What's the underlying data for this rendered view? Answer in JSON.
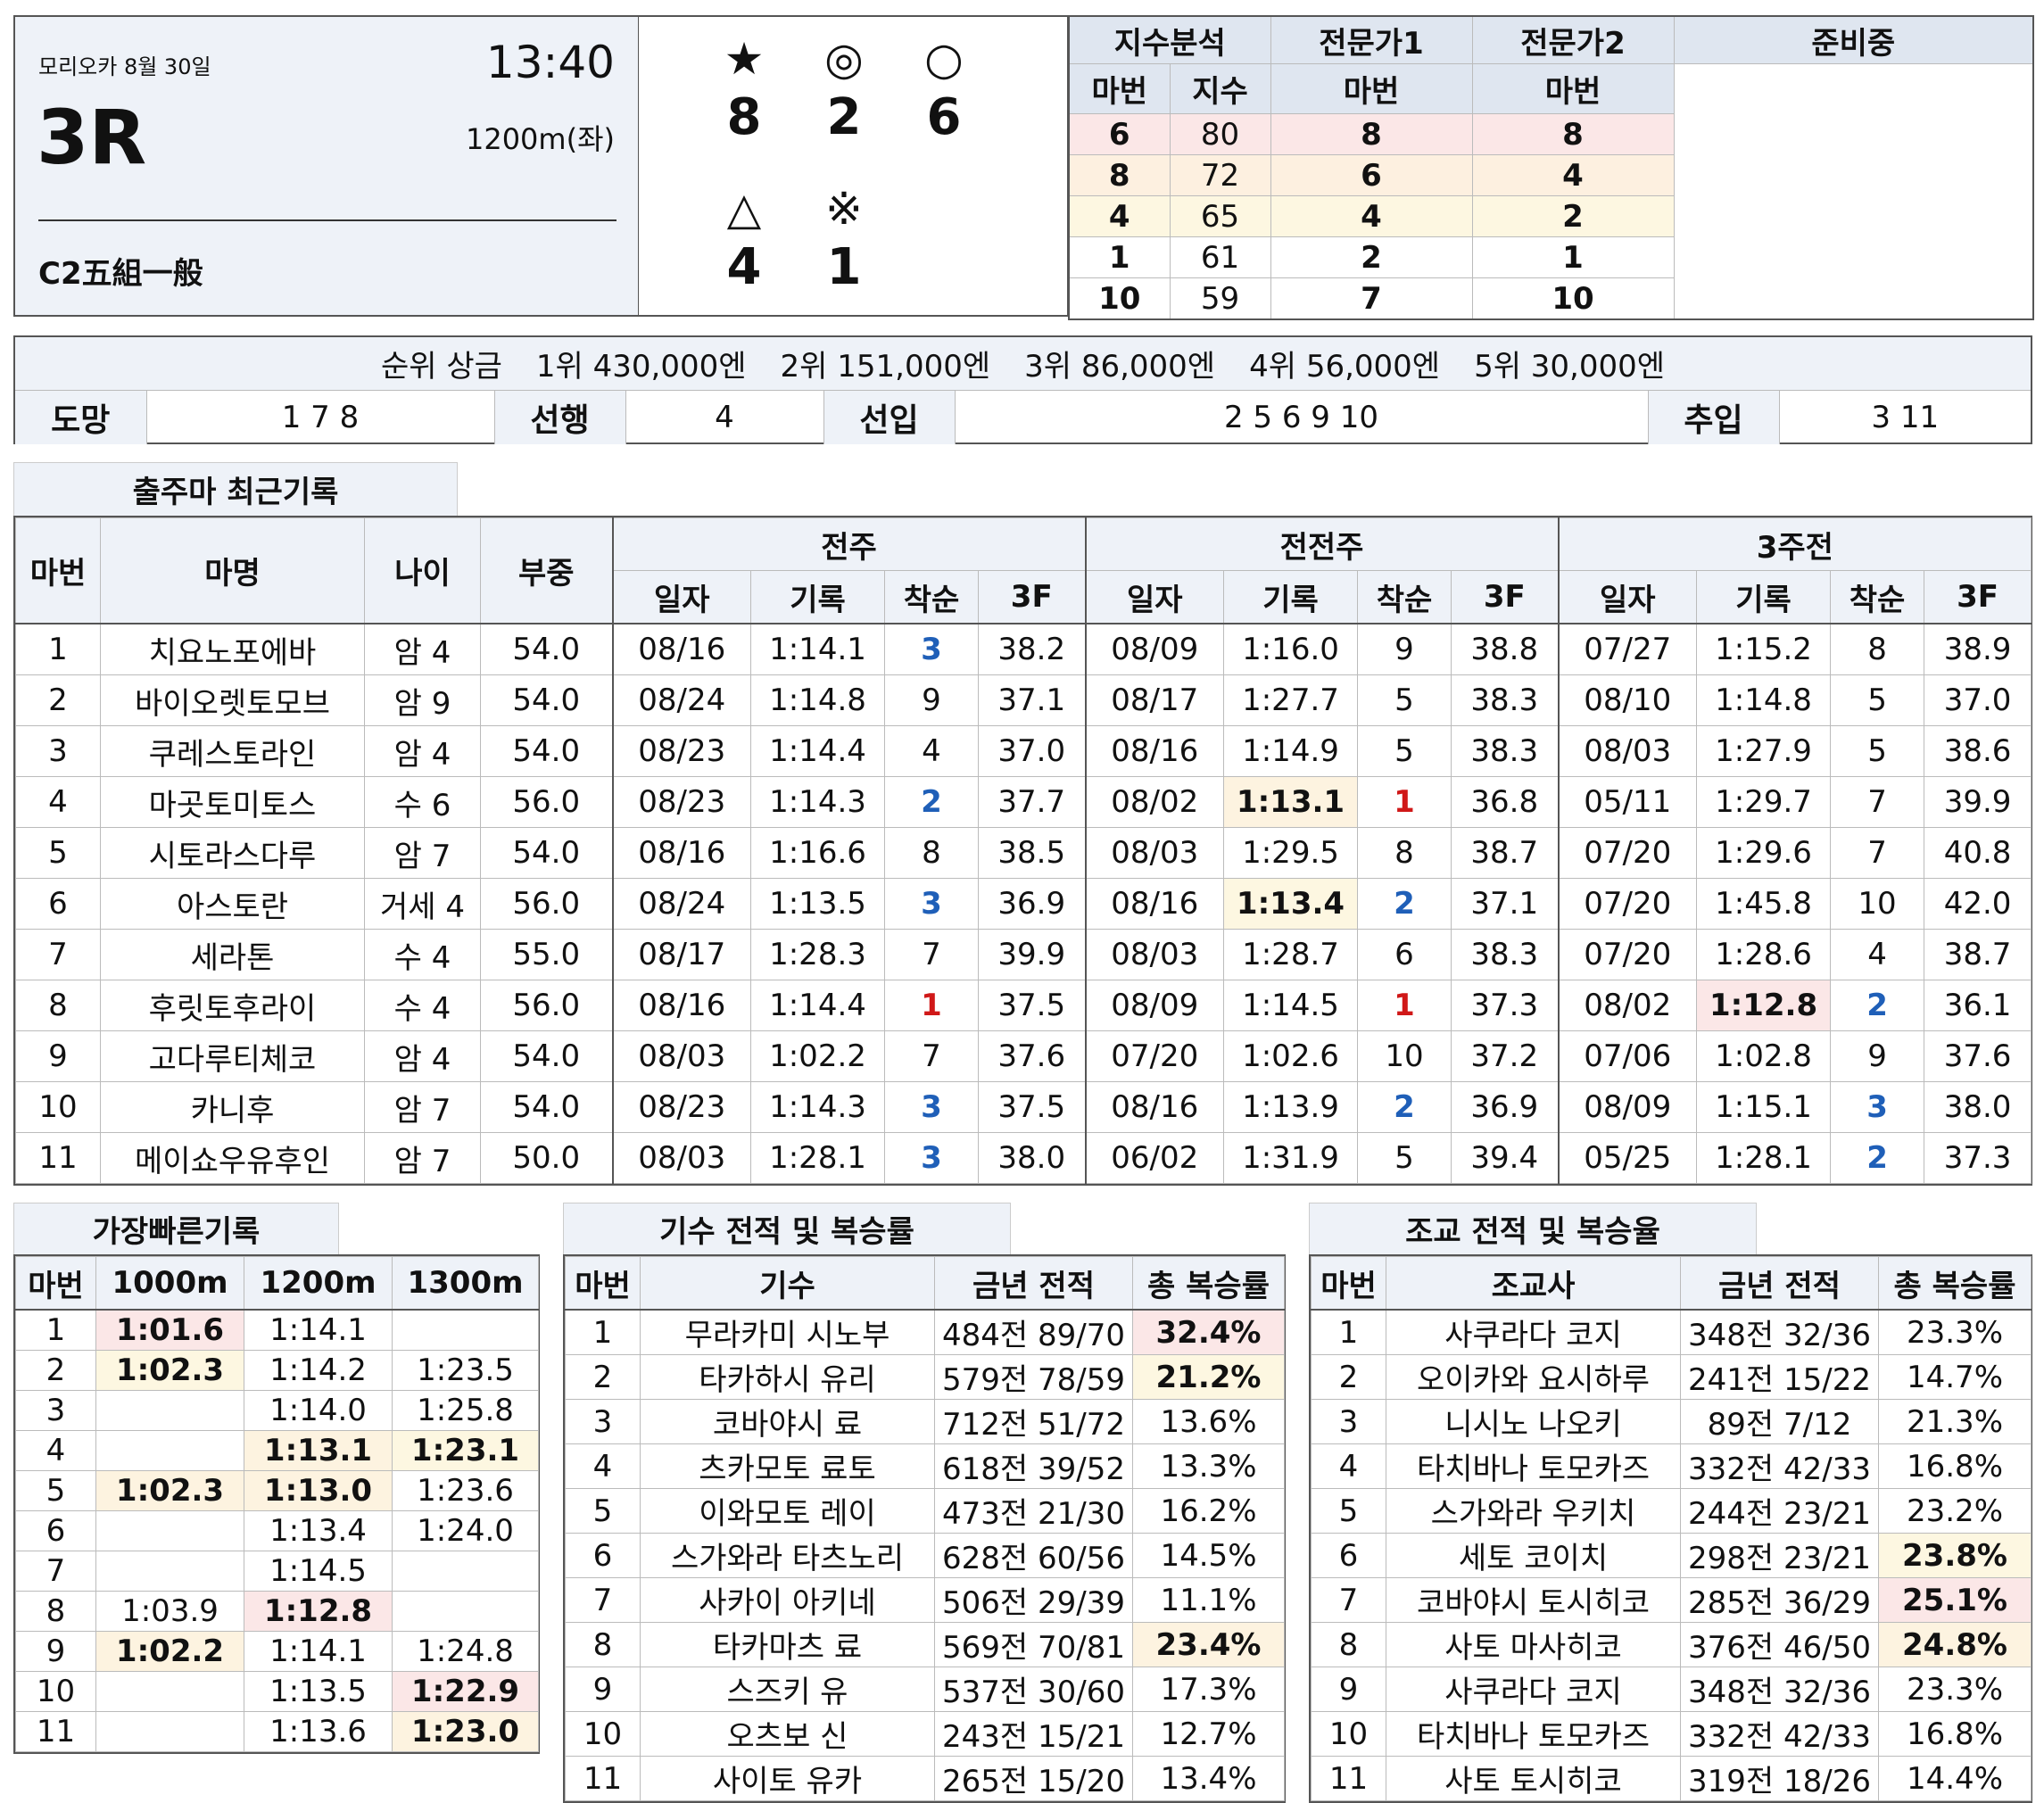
{
  "race": {
    "venue_date": "모리오카 8월 30일",
    "time": "13:40",
    "number": "3R",
    "distance": "1200m(좌)",
    "class": "C2五組一般"
  },
  "marks": [
    {
      "symbol": "★",
      "horse": "8"
    },
    {
      "symbol": "◎",
      "horse": "2"
    },
    {
      "symbol": "○",
      "horse": "6"
    },
    {
      "symbol": "△",
      "horse": "4"
    },
    {
      "symbol": "※",
      "horse": "1"
    }
  ],
  "picks": {
    "headers": [
      "지수분석",
      "전문가1",
      "전문가2",
      "준비중"
    ],
    "subheaders": [
      "마번",
      "지수",
      "마번",
      "마번"
    ],
    "rows": [
      {
        "index_horse": "6",
        "index_value": "80",
        "expert1": "8",
        "expert2": "8"
      },
      {
        "index_horse": "8",
        "index_value": "72",
        "expert1": "6",
        "expert2": "4"
      },
      {
        "index_horse": "4",
        "index_value": "65",
        "expert1": "4",
        "expert2": "2"
      },
      {
        "index_horse": "1",
        "index_value": "61",
        "expert1": "2",
        "expert2": "1"
      },
      {
        "index_horse": "10",
        "index_value": "59",
        "expert1": "7",
        "expert2": "10"
      }
    ]
  },
  "prize": {
    "label": "순위 상금",
    "items": [
      "1위 430,000엔",
      "2위 151,000엔",
      "3위 86,000엔",
      "4위 56,000엔",
      "5위 30,000엔"
    ]
  },
  "running_style": [
    {
      "label": "도망",
      "horses": "1  7  8"
    },
    {
      "label": "선행",
      "horses": "4"
    },
    {
      "label": "선입",
      "horses": "2  5  6  9  10"
    },
    {
      "label": "추입",
      "horses": "3  11"
    }
  ],
  "recent": {
    "title": "출주마 최근기록",
    "headers": {
      "num": "마번",
      "name": "마명",
      "age": "나이",
      "weight": "부중"
    },
    "periods": [
      "전주",
      "전전주",
      "3주전"
    ],
    "subheaders": [
      "일자",
      "기록",
      "착순",
      "3F"
    ],
    "rows": [
      {
        "num": "1",
        "name": "치요노포에바",
        "age": "암 4",
        "weight": "54.0",
        "runs": [
          [
            "08/16",
            "1:14.1",
            "3",
            "38.2"
          ],
          [
            "08/09",
            "1:16.0",
            "9",
            "38.8"
          ],
          [
            "07/27",
            "1:15.2",
            "8",
            "38.9"
          ]
        ]
      },
      {
        "num": "2",
        "name": "바이오렛토모브",
        "age": "암 9",
        "weight": "54.0",
        "runs": [
          [
            "08/24",
            "1:14.8",
            "9",
            "37.1"
          ],
          [
            "08/17",
            "1:27.7",
            "5",
            "38.3"
          ],
          [
            "08/10",
            "1:14.8",
            "5",
            "37.0"
          ]
        ]
      },
      {
        "num": "3",
        "name": "쿠레스토라인",
        "age": "암 4",
        "weight": "54.0",
        "runs": [
          [
            "08/23",
            "1:14.4",
            "4",
            "37.0"
          ],
          [
            "08/16",
            "1:14.9",
            "5",
            "38.3"
          ],
          [
            "08/03",
            "1:27.9",
            "5",
            "38.6"
          ]
        ]
      },
      {
        "num": "4",
        "name": "마곳토미토스",
        "age": "수 6",
        "weight": "56.0",
        "runs": [
          [
            "08/23",
            "1:14.3",
            "2",
            "37.7"
          ],
          [
            "08/02",
            "1:13.1",
            "1",
            "36.8"
          ],
          [
            "05/11",
            "1:29.7",
            "7",
            "39.9"
          ]
        ]
      },
      {
        "num": "5",
        "name": "시토라스다루",
        "age": "암 7",
        "weight": "54.0",
        "runs": [
          [
            "08/16",
            "1:16.6",
            "8",
            "38.5"
          ],
          [
            "08/03",
            "1:29.5",
            "8",
            "38.7"
          ],
          [
            "07/20",
            "1:29.6",
            "7",
            "40.8"
          ]
        ]
      },
      {
        "num": "6",
        "name": "아스토란",
        "age": "거세 4",
        "weight": "56.0",
        "runs": [
          [
            "08/24",
            "1:13.5",
            "3",
            "36.9"
          ],
          [
            "08/16",
            "1:13.4",
            "2",
            "37.1"
          ],
          [
            "07/20",
            "1:45.8",
            "10",
            "42.0"
          ]
        ]
      },
      {
        "num": "7",
        "name": "세라톤",
        "age": "수 4",
        "weight": "55.0",
        "runs": [
          [
            "08/17",
            "1:28.3",
            "7",
            "39.9"
          ],
          [
            "08/03",
            "1:28.7",
            "6",
            "38.3"
          ],
          [
            "07/20",
            "1:28.6",
            "4",
            "38.7"
          ]
        ]
      },
      {
        "num": "8",
        "name": "후릿토후라이",
        "age": "수 4",
        "weight": "56.0",
        "runs": [
          [
            "08/16",
            "1:14.4",
            "1",
            "37.5"
          ],
          [
            "08/09",
            "1:14.5",
            "1",
            "37.3"
          ],
          [
            "08/02",
            "1:12.8",
            "2",
            "36.1"
          ]
        ]
      },
      {
        "num": "9",
        "name": "고다루티체코",
        "age": "암 4",
        "weight": "54.0",
        "runs": [
          [
            "08/03",
            "1:02.2",
            "7",
            "37.6"
          ],
          [
            "07/20",
            "1:02.6",
            "10",
            "37.2"
          ],
          [
            "07/06",
            "1:02.8",
            "9",
            "37.6"
          ]
        ]
      },
      {
        "num": "10",
        "name": "카니후",
        "age": "암 7",
        "weight": "54.0",
        "runs": [
          [
            "08/23",
            "1:14.3",
            "3",
            "37.5"
          ],
          [
            "08/16",
            "1:13.9",
            "2",
            "36.9"
          ],
          [
            "08/09",
            "1:15.1",
            "3",
            "38.0"
          ]
        ]
      },
      {
        "num": "11",
        "name": "메이쇼우유후인",
        "age": "암 7",
        "weight": "50.0",
        "runs": [
          [
            "08/03",
            "1:28.1",
            "3",
            "38.0"
          ],
          [
            "06/02",
            "1:31.9",
            "5",
            "39.4"
          ],
          [
            "05/25",
            "1:28.1",
            "2",
            "37.3"
          ]
        ]
      }
    ]
  },
  "fastest": {
    "title": "가장빠른기록",
    "headers": [
      "마번",
      "1000m",
      "1200m",
      "1300m"
    ],
    "rows": [
      [
        "1",
        "1:01.6",
        "1:14.1",
        ""
      ],
      [
        "2",
        "1:02.3",
        "1:14.2",
        "1:23.5"
      ],
      [
        "3",
        "",
        "1:14.0",
        "1:25.8"
      ],
      [
        "4",
        "",
        "1:13.1",
        "1:23.1"
      ],
      [
        "5",
        "1:02.3",
        "1:13.0",
        "1:23.6"
      ],
      [
        "6",
        "",
        "1:13.4",
        "1:24.0"
      ],
      [
        "7",
        "",
        "1:14.5",
        ""
      ],
      [
        "8",
        "1:03.9",
        "1:12.8",
        ""
      ],
      [
        "9",
        "1:02.2",
        "1:14.1",
        "1:24.8"
      ],
      [
        "10",
        "",
        "1:13.5",
        "1:22.9"
      ],
      [
        "11",
        "",
        "1:13.6",
        "1:23.0"
      ]
    ]
  },
  "jockeys": {
    "title": "기수 전적 및 복승률",
    "headers": [
      "마번",
      "기수",
      "금년 전적",
      "총 복승률"
    ],
    "rows": [
      [
        "1",
        "무라카미 시노부",
        "484전 89/70",
        "32.4%"
      ],
      [
        "2",
        "타카하시 유리",
        "579전 78/59",
        "21.2%"
      ],
      [
        "3",
        "코바야시 료",
        "712전 51/72",
        "13.6%"
      ],
      [
        "4",
        "츠카모토 료토",
        "618전 39/52",
        "13.3%"
      ],
      [
        "5",
        "이와모토 레이",
        "473전 21/30",
        "16.2%"
      ],
      [
        "6",
        "스가와라 타츠노리",
        "628전 60/56",
        "14.5%"
      ],
      [
        "7",
        "사카이 아키네",
        "506전 29/39",
        "11.1%"
      ],
      [
        "8",
        "타카마츠 료",
        "569전 70/81",
        "23.4%"
      ],
      [
        "9",
        "스즈키 유",
        "537전 30/60",
        "17.3%"
      ],
      [
        "10",
        "오츠보 신",
        "243전 15/21",
        "12.7%"
      ],
      [
        "11",
        "사이토 유카",
        "265전 15/20",
        "13.4%"
      ]
    ]
  },
  "trainers": {
    "title": "조교 전적 및 복승율",
    "headers": [
      "마번",
      "조교사",
      "금년 전적",
      "총 복승률"
    ],
    "rows": [
      [
        "1",
        "사쿠라다 코지",
        "348전 32/36",
        "23.3%"
      ],
      [
        "2",
        "오이카와 요시하루",
        "241전 15/22",
        "14.7%"
      ],
      [
        "3",
        "니시노 나오키",
        "89전 7/12",
        "21.3%"
      ],
      [
        "4",
        "타치바나 토모카즈",
        "332전 42/33",
        "16.8%"
      ],
      [
        "5",
        "스가와라 우키치",
        "244전 23/21",
        "23.2%"
      ],
      [
        "6",
        "세토 코이치",
        "298전 23/21",
        "23.8%"
      ],
      [
        "7",
        "코바야시 토시히코",
        "285전 36/29",
        "25.1%"
      ],
      [
        "8",
        "사토 마사히코",
        "376전 46/50",
        "24.8%"
      ],
      [
        "9",
        "사쿠라다 코지",
        "348전 32/36",
        "23.3%"
      ],
      [
        "10",
        "타치바나 토모카즈",
        "332전 42/33",
        "16.8%"
      ],
      [
        "11",
        "사토 토시히코",
        "319전 18/26",
        "14.4%"
      ]
    ]
  }
}
